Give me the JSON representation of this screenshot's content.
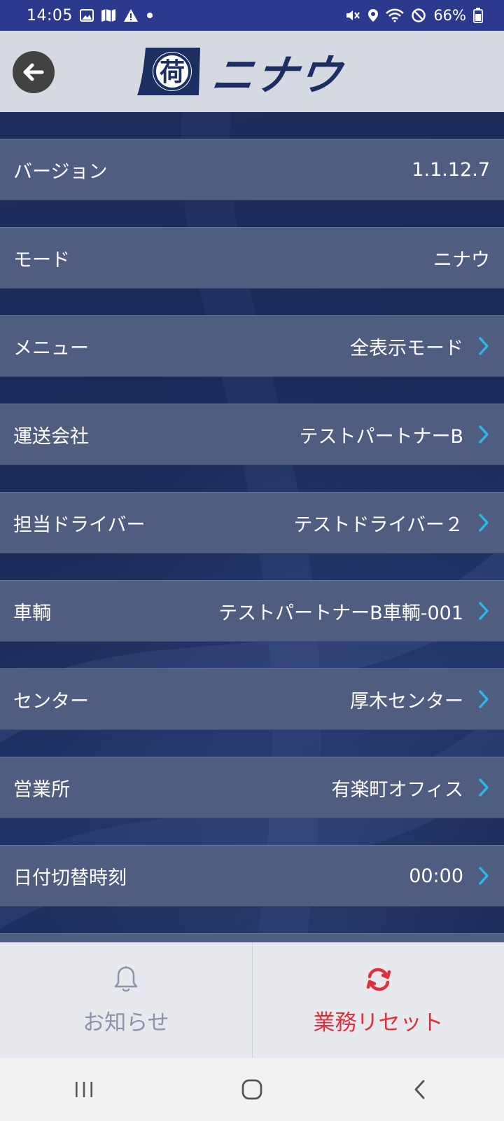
{
  "status_bar": {
    "time": "14:05",
    "battery_percent": "66%",
    "left_icons": [
      "gallery-icon",
      "map-icon",
      "alert-icon",
      "dot-icon"
    ],
    "right_icons": [
      "mute-icon",
      "location-icon",
      "wifi-icon",
      "block-icon",
      "battery-icon"
    ]
  },
  "header": {
    "logo_emblem_char": "荷",
    "logo_text": "ニナウ",
    "back_icon": "back-arrow-icon"
  },
  "settings": {
    "rows": [
      {
        "label": "バージョン",
        "value": "1.1.12.7",
        "navigable": false
      },
      {
        "label": "モード",
        "value": "ニナウ",
        "navigable": false
      },
      {
        "label": "メニュー",
        "value": "全表示モード",
        "navigable": true
      },
      {
        "label": "運送会社",
        "value": "テストパートナーB",
        "navigable": true
      },
      {
        "label": "担当ドライバー",
        "value": "テストドライバー２",
        "navigable": true
      },
      {
        "label": "車輌",
        "value": "テストパートナーB車輌-001",
        "navigable": true
      },
      {
        "label": "センター",
        "value": "厚木センター",
        "navigable": true
      },
      {
        "label": "営業所",
        "value": "有楽町オフィス",
        "navigable": true
      },
      {
        "label": "日付切替時刻",
        "value": "00:00",
        "navigable": true
      }
    ]
  },
  "actions": {
    "notice_label": "お知らせ",
    "reset_label": "業務リセット"
  },
  "colors": {
    "status_bar": "#2b3a8e",
    "header_bg": "#d5d9e2",
    "row_bg": "#4e5d80",
    "chevron": "#2fb6e8",
    "reset_red": "#e0303c",
    "notice_gray": "#8d93aa"
  }
}
